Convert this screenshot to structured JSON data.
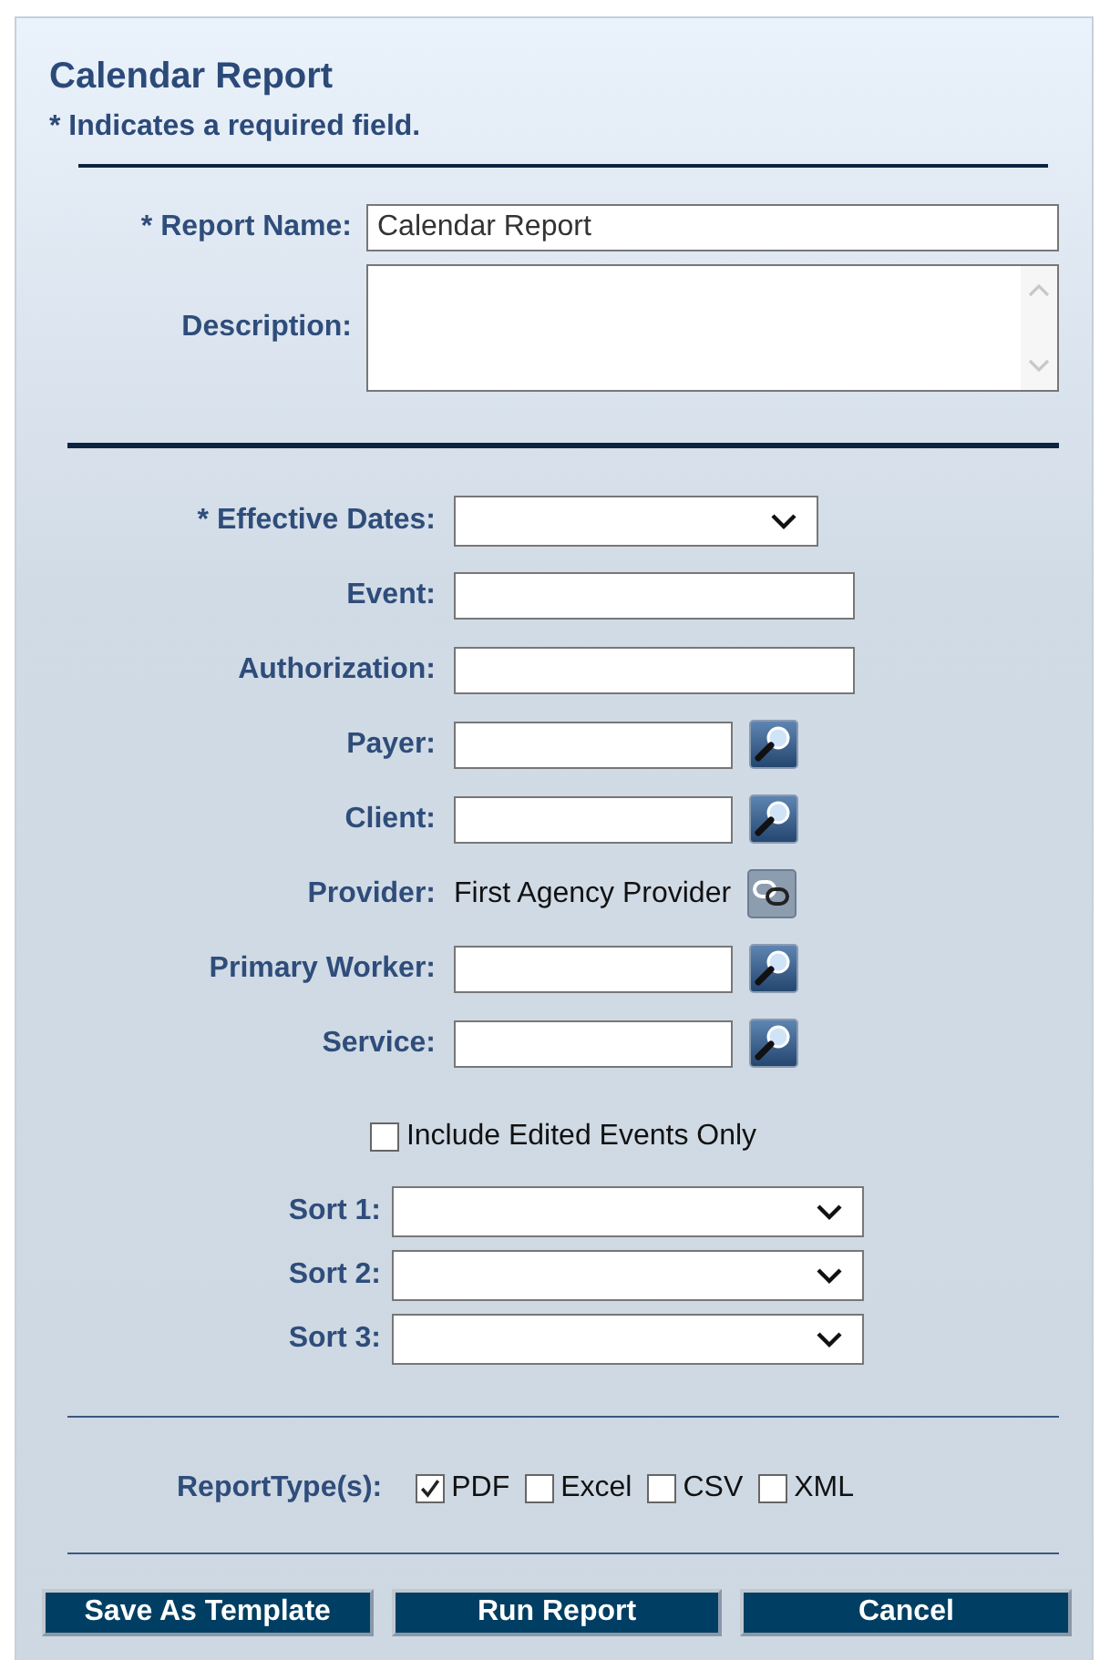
{
  "title": "Calendar Report",
  "note": "* Indicates a required field.",
  "top_fields": [
    {
      "kind": "text",
      "label": "* Report Name:",
      "value": "Calendar Report"
    },
    {
      "kind": "textarea",
      "label": "Description:"
    }
  ],
  "filters": [
    {
      "kind": "select",
      "label": "* Effective Dates:"
    },
    {
      "kind": "text",
      "label": "Event:"
    },
    {
      "kind": "text",
      "label": "Authorization:"
    },
    {
      "kind": "lookup",
      "label": "Payer:"
    },
    {
      "kind": "lookup",
      "label": "Client:"
    },
    {
      "kind": "static",
      "label": "Provider:",
      "value": "First Agency Provider"
    },
    {
      "kind": "lookup",
      "label": "Primary Worker:"
    },
    {
      "kind": "lookup",
      "label": "Service:"
    }
  ],
  "include_edited": {
    "label": "Include Edited Events Only",
    "checked": false
  },
  "sorts": [
    {
      "label": "Sort 1:"
    },
    {
      "label": "Sort 2:"
    },
    {
      "label": "Sort 3:"
    }
  ],
  "report_types": {
    "label": "ReportType(s):",
    "options": [
      {
        "label": "PDF",
        "checked": true
      },
      {
        "label": "Excel",
        "checked": false
      },
      {
        "label": "CSV",
        "checked": false
      },
      {
        "label": "XML",
        "checked": false
      }
    ]
  },
  "buttons": [
    "Save As Template",
    "Run Report",
    "Cancel"
  ]
}
